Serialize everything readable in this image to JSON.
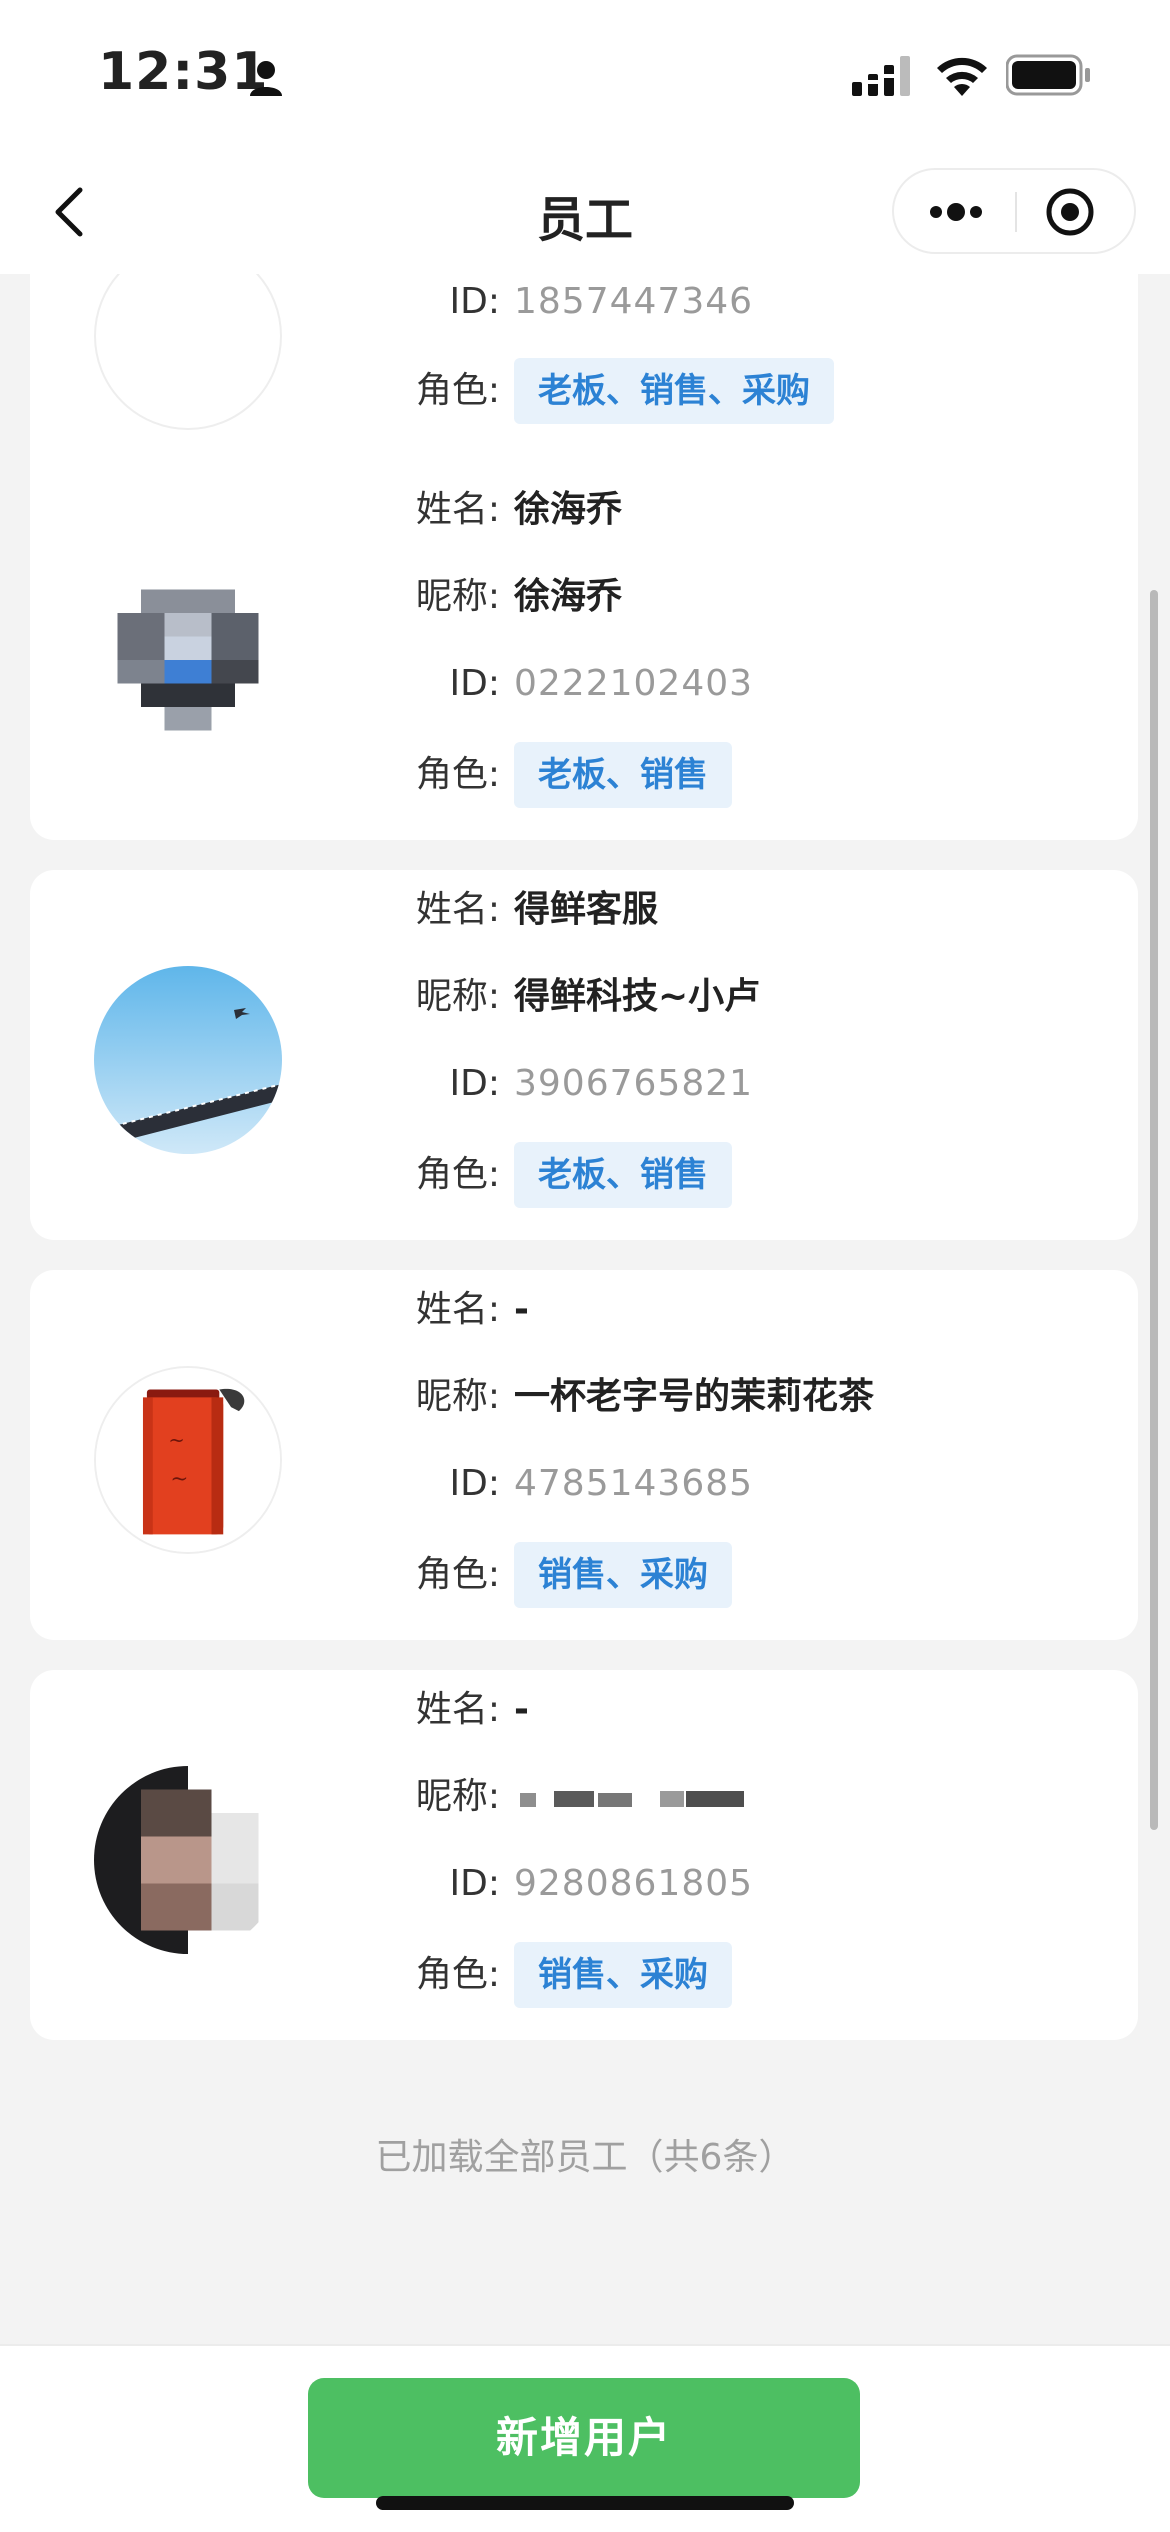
{
  "status_bar": {
    "time": "12:31"
  },
  "nav": {
    "title": "员工"
  },
  "labels": {
    "name": "姓名:",
    "nickname": "昵称:",
    "id": "ID:",
    "role": "角色:"
  },
  "employees": [
    {
      "name": "",
      "nickname": "",
      "id": "1857447346",
      "roles": "老板、销售、采购"
    },
    {
      "name": "徐海乔",
      "nickname": "徐海乔",
      "id": "0222102403",
      "roles": "老板、销售"
    },
    {
      "name": "得鲜客服",
      "nickname": "得鲜科技~小卢",
      "id": "3906765821",
      "roles": "老板、销售"
    },
    {
      "name": "-",
      "nickname": "一杯老字号的茉莉花茶",
      "id": "4785143685",
      "roles": "销售、采购"
    },
    {
      "name": "-",
      "nickname": "",
      "id": "9280861805",
      "roles": "销售、采购"
    }
  ],
  "footer_text": "已加载全部员工（共6条）",
  "add_button_label": "新增用户"
}
